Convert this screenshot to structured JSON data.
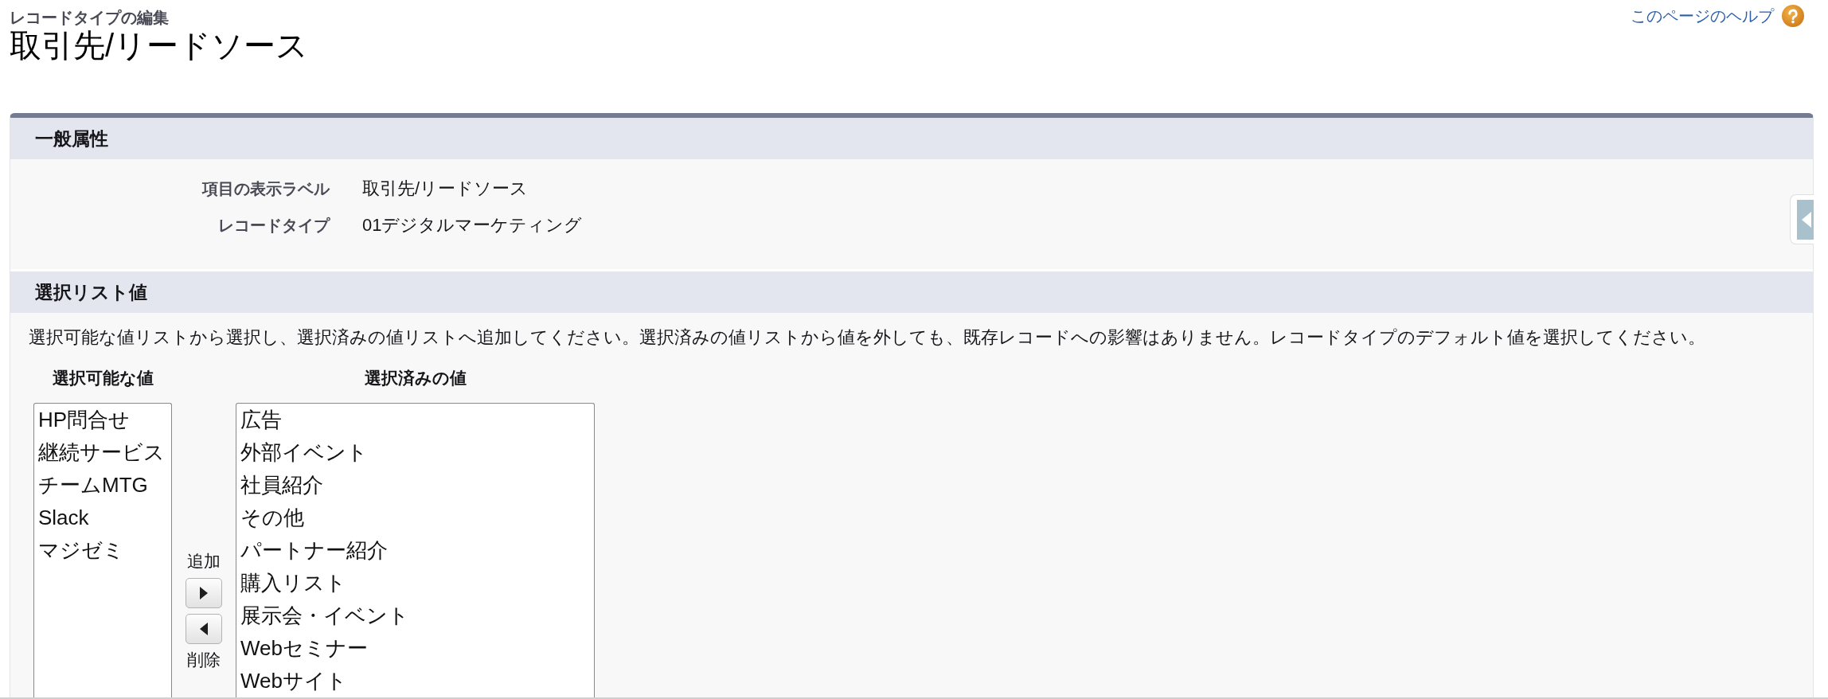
{
  "page": {
    "subtitle": "レコードタイプの編集",
    "title": "取引先/リードソース",
    "help_link": "このページのヘルプ"
  },
  "general_section": {
    "heading": "一般属性",
    "fields": [
      {
        "label": "項目の表示ラベル",
        "value": "取引先/リードソース"
      },
      {
        "label": "レコードタイプ",
        "value": "01デジタルマーケティング"
      }
    ]
  },
  "picklist_section": {
    "heading": "選択リスト値",
    "instructions": "選択可能な値リストから選択し、選択済みの値リストへ追加してください。選択済みの値リストから値を外しても、既存レコードへの影響はありません。レコードタイプのデフォルト値を選択してください。",
    "available": {
      "heading": "選択可能な値",
      "items": [
        {
          "label": "HP問合せ",
          "selected": false
        },
        {
          "label": "継続サービス",
          "selected": false
        },
        {
          "label": "チームMTG",
          "selected": false
        },
        {
          "label": "Slack",
          "selected": false
        },
        {
          "label": "マジゼミ",
          "selected": false
        }
      ]
    },
    "add_label": "追加",
    "remove_label": "削除",
    "chosen": {
      "heading": "選択済みの値",
      "items": [
        {
          "label": "広告",
          "selected": false
        },
        {
          "label": "外部イベント",
          "selected": false
        },
        {
          "label": "社員紹介",
          "selected": false
        },
        {
          "label": "その他",
          "selected": false
        },
        {
          "label": "パートナー紹介",
          "selected": false
        },
        {
          "label": "購入リスト",
          "selected": false
        },
        {
          "label": "展示会・イベント",
          "selected": false
        },
        {
          "label": "Webセミナー",
          "selected": false
        },
        {
          "label": "Webサイト",
          "selected": false
        }
      ]
    }
  }
}
